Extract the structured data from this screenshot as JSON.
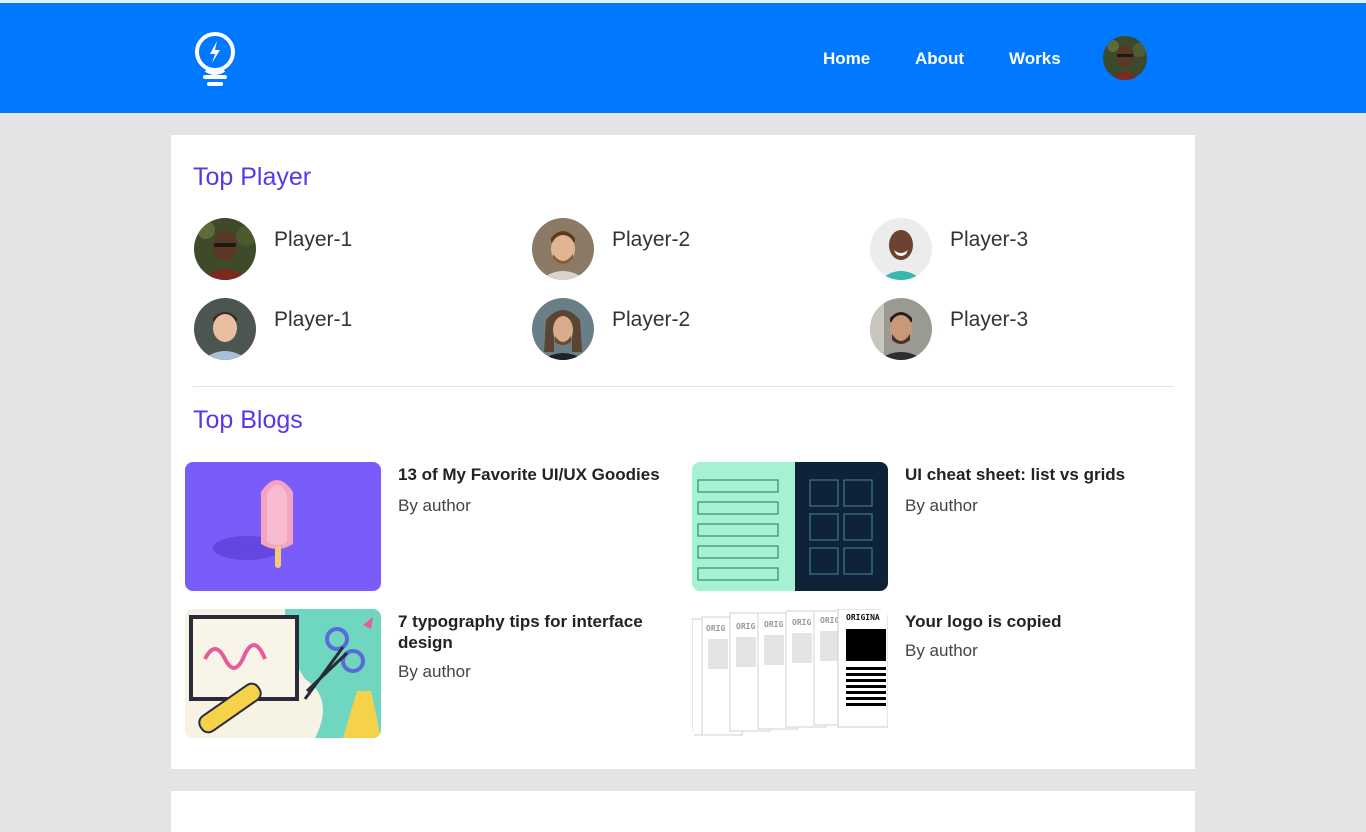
{
  "nav": {
    "links": [
      "Home",
      "About",
      "Works"
    ]
  },
  "top_player": {
    "title": "Top Player",
    "players": [
      {
        "name": "Player-1"
      },
      {
        "name": "Player-2"
      },
      {
        "name": "Player-3"
      },
      {
        "name": "Player-1"
      },
      {
        "name": "Player-2"
      },
      {
        "name": "Player-3"
      }
    ]
  },
  "top_blogs": {
    "title": "Top Blogs",
    "blogs": [
      {
        "title": "13 of My Favorite UI/UX Goodies",
        "author": "By author"
      },
      {
        "title": "UI cheat sheet: list vs grids",
        "author": "By author"
      },
      {
        "title": "7 typography tips for interface design",
        "author": "By author"
      },
      {
        "title": "Your logo is copied",
        "author": "By author"
      }
    ],
    "thumb_text": {
      "original": "ORIGINA",
      "orig": "ORIG"
    }
  },
  "colors": {
    "navbar": "#0078ff",
    "accent_title": "#5a36e8",
    "page_bg": "#e4e4e4"
  }
}
